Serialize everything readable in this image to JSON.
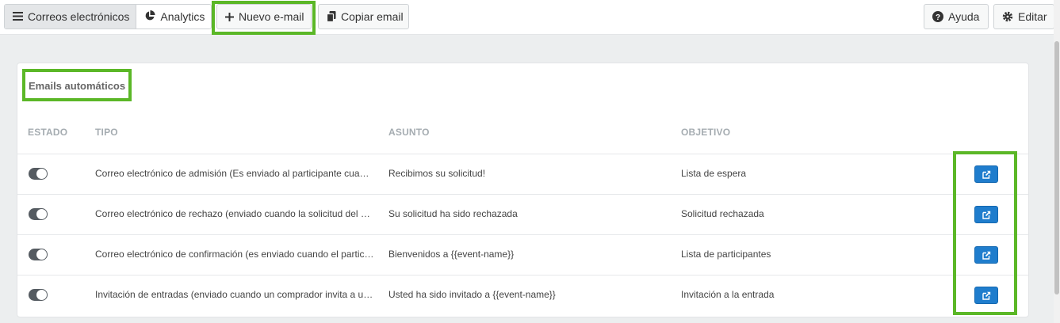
{
  "toolbar": {
    "tabs": [
      {
        "label": "Correos electrónicos",
        "icon": "hamburger-icon"
      },
      {
        "label": "Analytics",
        "icon": "pie-chart-icon"
      }
    ],
    "new_email": {
      "label": "Nuevo e-mail",
      "icon": "plus-icon"
    },
    "copy_email": {
      "label": "Copiar email",
      "icon": "copy-icon"
    },
    "help": {
      "label": "Ayuda",
      "icon": "question-circle-icon"
    },
    "edit": {
      "label": "Editar",
      "icon": "gear-icon"
    }
  },
  "card": {
    "title": "Emails automáticos",
    "columns": [
      "ESTADO",
      "TIPO",
      "ASUNTO",
      "OBJETIVO"
    ],
    "rows": [
      {
        "enabled": true,
        "tipo": "Correo electrónico de admisión (Es enviado al participante cuando se registra en la lista de espera)",
        "asunto": "Recibimos su solicitud!",
        "objetivo": "Lista de espera"
      },
      {
        "enabled": true,
        "tipo": "Correo electrónico de rechazo (enviado cuando la solicitud del asistente es rechazada)",
        "asunto": "Su solicitud ha sido rechazada",
        "objetivo": "Solicitud rechazada"
      },
      {
        "enabled": true,
        "tipo": "Correo electrónico de confirmación (es enviado cuando el participante es aceptado)",
        "asunto": "Bienvenidos a {{event-name}}",
        "objetivo": "Lista de participantes"
      },
      {
        "enabled": true,
        "tipo": "Invitación de entradas (enviado cuando un comprador invita a un tercero)",
        "asunto": "Usted ha sido invitado a {{event-name}}",
        "objetivo": "Invitación a la entrada"
      }
    ]
  },
  "colors": {
    "highlight": "#5bb727",
    "edit_button": "#1f7dcd",
    "toggle_on": "#555b61"
  }
}
